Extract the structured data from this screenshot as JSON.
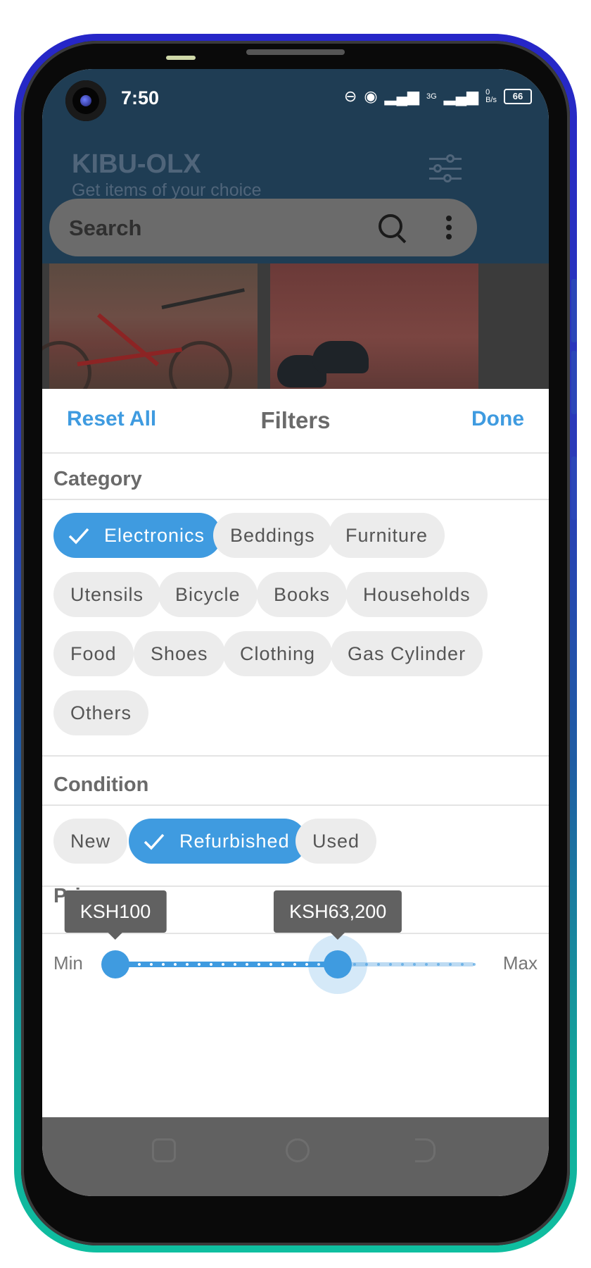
{
  "status_bar": {
    "time": "7:50",
    "signal_label": "3G",
    "data_rate": "0\nB/s",
    "battery": "66"
  },
  "app": {
    "title": "KIBU-OLX",
    "subtitle": "Get items of your choice"
  },
  "search": {
    "placeholder": "Search"
  },
  "filters": {
    "reset_label": "Reset All",
    "title": "Filters",
    "done_label": "Done",
    "category": {
      "title": "Category",
      "chips": [
        {
          "label": "Electronics",
          "selected": true
        },
        {
          "label": "Beddings",
          "selected": false
        },
        {
          "label": "Furniture",
          "selected": false
        },
        {
          "label": "Utensils",
          "selected": false
        },
        {
          "label": "Bicycle",
          "selected": false
        },
        {
          "label": "Books",
          "selected": false
        },
        {
          "label": "Households",
          "selected": false
        },
        {
          "label": "Food",
          "selected": false
        },
        {
          "label": "Shoes",
          "selected": false
        },
        {
          "label": "Clothing",
          "selected": false
        },
        {
          "label": "Gas Cylinder",
          "selected": false
        },
        {
          "label": "Others",
          "selected": false
        }
      ]
    },
    "condition": {
      "title": "Condition",
      "chips": [
        {
          "label": "New",
          "selected": false
        },
        {
          "label": "Refurbished",
          "selected": true
        },
        {
          "label": "Used",
          "selected": false
        }
      ]
    },
    "price": {
      "title": "Price",
      "min_label": "Min",
      "max_label": "Max",
      "low_value": "KSH100",
      "high_value": "KSH63,200",
      "low_fraction": 0.0,
      "high_fraction": 0.62
    }
  },
  "colors": {
    "accent": "#3f9be0",
    "header": "#1f3d54",
    "chip_bg": "#ececec"
  },
  "icons": {
    "filter": "sliders-icon",
    "search": "search-icon",
    "menu": "more-vert-icon",
    "check": "check-icon"
  }
}
